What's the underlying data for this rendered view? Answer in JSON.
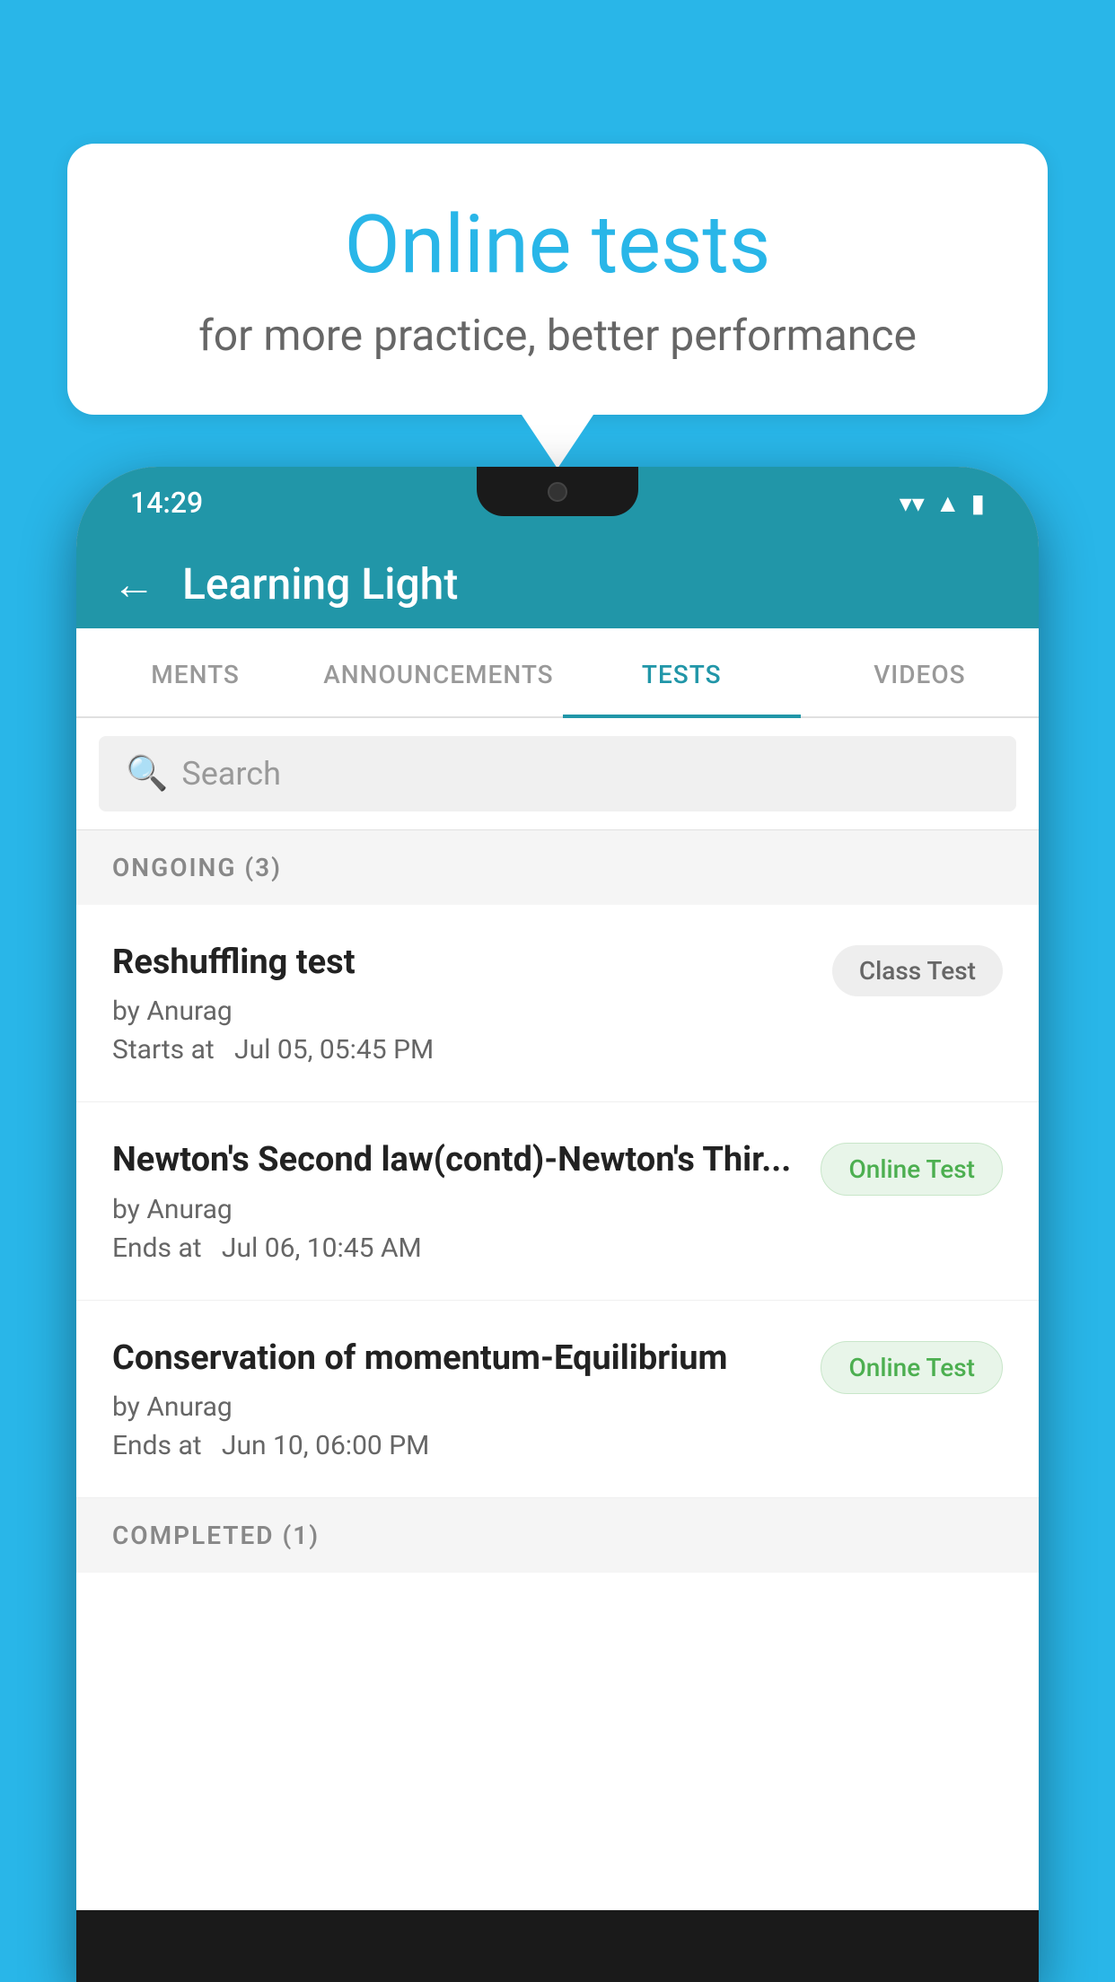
{
  "background_color": "#29B6E8",
  "speech_bubble": {
    "title": "Online tests",
    "subtitle": "for more practice, better performance"
  },
  "phone": {
    "status_bar": {
      "time": "14:29",
      "icons": [
        "wifi",
        "signal",
        "battery"
      ]
    },
    "app_bar": {
      "title": "Learning Light",
      "back_label": "←"
    },
    "tabs": [
      {
        "label": "MENTS",
        "active": false
      },
      {
        "label": "ANNOUNCEMENTS",
        "active": false
      },
      {
        "label": "TESTS",
        "active": true
      },
      {
        "label": "VIDEOS",
        "active": false
      }
    ],
    "search": {
      "placeholder": "Search"
    },
    "sections": [
      {
        "header": "ONGOING (3)",
        "items": [
          {
            "title": "Reshuffling test",
            "by": "by Anurag",
            "date": "Starts at  Jul 05, 05:45 PM",
            "badge": "Class Test",
            "badge_type": "class"
          },
          {
            "title": "Newton's Second law(contd)-Newton's Thir...",
            "by": "by Anurag",
            "date": "Ends at  Jul 06, 10:45 AM",
            "badge": "Online Test",
            "badge_type": "online"
          },
          {
            "title": "Conservation of momentum-Equilibrium",
            "by": "by Anurag",
            "date": "Ends at  Jun 10, 06:00 PM",
            "badge": "Online Test",
            "badge_type": "online"
          }
        ]
      },
      {
        "header": "COMPLETED (1)",
        "items": []
      }
    ]
  }
}
